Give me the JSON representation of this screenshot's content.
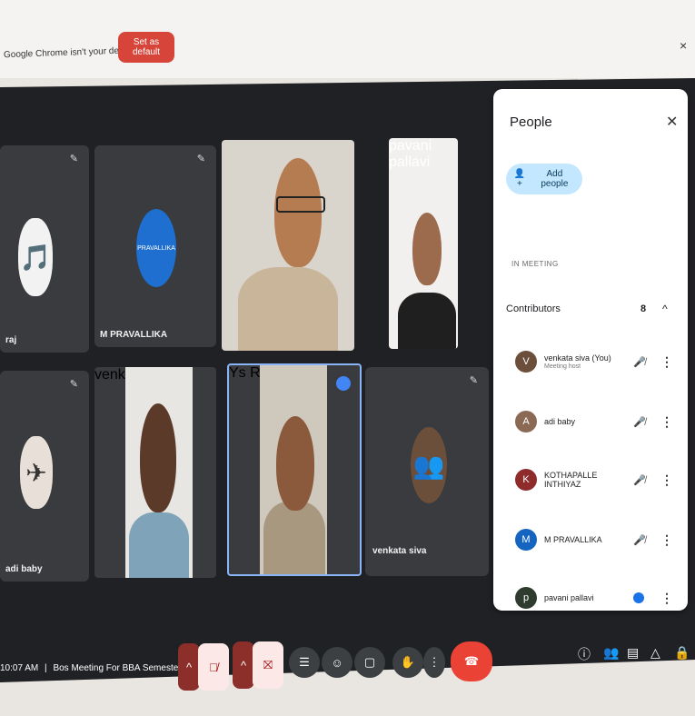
{
  "browser_bar": {
    "message": "Google Chrome isn't your default browser",
    "set_default_label": "Set as default",
    "close_glyph": "×"
  },
  "tiles": {
    "top_left_label": "raj",
    "pravallika_label": "M PRAVALLIKA",
    "pavani_label": "pavani pallavi",
    "adi_label": "adi baby",
    "venkata_label_1": "venkata siva",
    "ravi_label": "Ys Ravi",
    "venkata_label_2": "venkata siva",
    "pravallika_avatar_text": "PRAVALLIKA"
  },
  "people_panel": {
    "title": "People",
    "close_glyph": "✕",
    "add_people_label": "Add people",
    "section_label": "IN MEETING",
    "group_label": "Contributors",
    "group_count": "8",
    "group_chevron": "^",
    "participants": [
      {
        "name": "venkata siva (You)",
        "sub": "Meeting host",
        "initial": "V",
        "color": "#6b4f3a"
      },
      {
        "name": "adi baby",
        "sub": "",
        "initial": "A",
        "color": "#8a6a55"
      },
      {
        "name": "KOTHAPALLE INTHIYAZ",
        "sub": "",
        "initial": "K",
        "color": "#8e2c2c"
      },
      {
        "name": "M PRAVALLIKA",
        "sub": "",
        "initial": "M",
        "color": "#1565c0"
      },
      {
        "name": "pavani pallavi",
        "sub": "",
        "initial": "p",
        "color": "#2e3b2e"
      }
    ]
  },
  "bottom_bar": {
    "time": "10:07 AM",
    "separator": "|",
    "meeting_title": "Bos Meeting For BBA Semester-II"
  },
  "colors": {
    "accent_red": "#ea4335",
    "add_people_bg": "#c2e7ff",
    "stage_bg": "#202124"
  }
}
